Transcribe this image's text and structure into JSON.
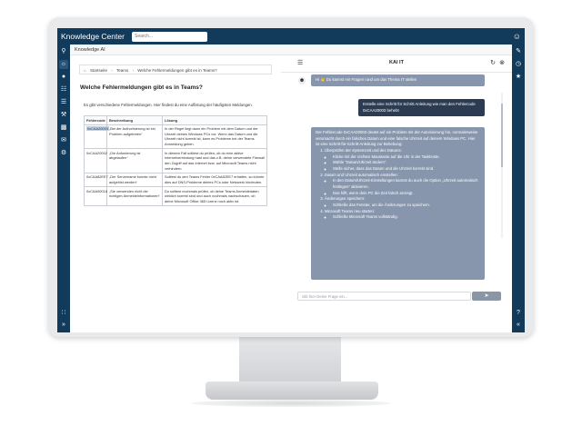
{
  "app": {
    "title": "Knowledge Center",
    "search_placeholder": "Search...",
    "section": "Knowledge AI"
  },
  "breadcrumb": {
    "home": "Startseite",
    "teams": "Teams",
    "current": "Welche Fehlermeldungen gibt es in Teams?"
  },
  "doc": {
    "title": "Welche Fehlermeldungen gibt es in Teams?",
    "intro": "Es gibt verschiedene Fehlermeldungen. Hier findest du eine Auflistung der häufigsten Meldungen.",
    "table": {
      "headers": [
        "Fehlercode",
        "Beschreibung",
        "Lösung"
      ],
      "rows": [
        [
          "0xCAA20003",
          "„Bei der Authorisierung ist ein Problem aufgetreten“",
          "In der Regel liegt dann ein Problem mit dem Datum und der Uhrzeit deines Windows PCs vor. Wenn das Datum und die Uhrzeit nicht korrekt ist, kann es Probleme bei der Teams Anmeldung geben."
        ],
        [
          "0xCAA20002",
          "„Die Anforderung ist abgelaufen“",
          "In diesem Fall solltest du prüfen, ob du eine aktive Internetverbindung hast und das z.B. deine verwendete Firewall den Zugriff auf das Internet bzw. auf Microsoft Teams nicht verhindern."
        ],
        [
          "0xCAA82EE7",
          "„Der Servername konnte nicht aufgelöst werden“",
          "Solltest du den Teams Fehler 0xCAA82EE7 erhalten, so könnte dies auf DNS-Probleme deines PCs oder Netzwerk hindeuten."
        ],
        [
          "0xCAA90018",
          "„Sie verwenden nicht die richtigen Anmeldeinformationen“",
          "Du solltest nochmals prüfen, ob deine Teams Anmeldedaten wirklich korrekt sind und auch nochmals nachschauen, ob deine Microsoft Office 365 Lizenz noch aktiv ist."
        ]
      ]
    }
  },
  "chat": {
    "title": "KAI IT",
    "greeting": "Hi 👋 Du kannst mir Fragen rund um das Thema IT stellen",
    "user_message": "Erstelle eine Schritt für Schritt Anleitung wie man den Fehlercode 0xCAA20003 behebt",
    "bot_intro": "Der Fehlercode 0xCAA20003 deutet auf ein Problem mit der Autorisierung hin, normalerweise verursacht durch ein falsches Datum und eine falsche Uhrzeit auf deinem Windows PC. Hier ist eine Schritt-für-Schritt-Anleitung zur Behebung:",
    "steps": [
      {
        "label": "Überprüfen der Systemzeit und des Datums:",
        "sub": [
          "Klicke mit der rechten Maustaste auf die Uhr in der Taskleiste.",
          "Wähle \"Datum/Uhrzeit ändern\".",
          "Stelle sicher, dass das Datum und die Uhrzeit korrekt sind."
        ]
      },
      {
        "label": "Datum und Uhrzeit automatisch einstellen:",
        "sub": [
          "In den Datum/Uhrzeit-Einstellungen kannst du auch die Option „Uhrzeit automatisch festlegen“ aktivieren.",
          "Das hilft, wenn dein PC die Zeit falsch anzeigt."
        ]
      },
      {
        "label": "Änderungen speichern:",
        "sub": [
          "Schließe das Fenster, um die Änderungen zu speichern."
        ]
      },
      {
        "label": "Microsoft Teams neu starten:",
        "sub": [
          "Schließe Microsoft Teams vollständig."
        ]
      }
    ],
    "input_placeholder": "Gib hier Deine Frage ein...",
    "send_icon": "send-icon"
  }
}
